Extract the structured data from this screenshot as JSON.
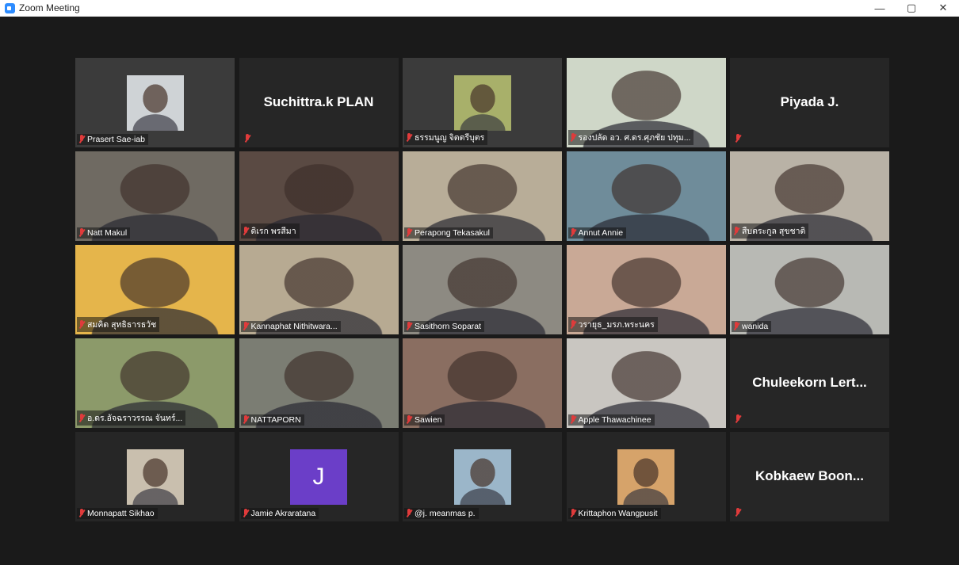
{
  "window": {
    "title": "Zoom Meeting",
    "minimize": "—",
    "maximize": "▢",
    "close": "✕"
  },
  "participants": [
    {
      "name": "Prasert Sae-iab",
      "kind": "video",
      "bg": "#3b3b3b",
      "thumb": true,
      "thumbColor": "#cfd3d6"
    },
    {
      "name": "Suchittra.k PLAN",
      "kind": "name"
    },
    {
      "name": "ธรรมนูญ จิตตรีบุตร",
      "kind": "video",
      "bg": "#3b3b3b",
      "thumb": true,
      "thumbColor": "#a8b06a"
    },
    {
      "name": "รองปลัด อว. ศ.ดร.ศุภชัย ปทุม...",
      "kind": "video",
      "bg": "#cfd7c8",
      "speaking": true
    },
    {
      "name": "Piyada J.",
      "kind": "name"
    },
    {
      "name": "Natt Makul",
      "kind": "video",
      "bg": "#6f6a62"
    },
    {
      "name": "ดิเรก พรสีมา",
      "kind": "video",
      "bg": "#5a4a43"
    },
    {
      "name": "Perapong Tekasakul",
      "kind": "video",
      "bg": "#b8ad98"
    },
    {
      "name": "Annut Annie",
      "kind": "video",
      "bg": "#6f8c9a"
    },
    {
      "name": "สืบตระกูล สุขชาติ",
      "kind": "video",
      "bg": "#b9b2a6"
    },
    {
      "name": "สมคิด สุทธิธารธวัช",
      "kind": "video",
      "bg": "#e5b54b"
    },
    {
      "name": "Kannaphat Nithitwara...",
      "kind": "video",
      "bg": "#b7aa92"
    },
    {
      "name": "Sasithorn Soparat",
      "kind": "video",
      "bg": "#8d8a82"
    },
    {
      "name": "วรายุธ_มรภ.พระนคร",
      "kind": "video",
      "bg": "#c9a996"
    },
    {
      "name": "wanida",
      "kind": "video",
      "bg": "#b8b9b4"
    },
    {
      "name": "อ.ดร.อัจฉราวรรณ จันทร์...",
      "kind": "video",
      "bg": "#8c9a6a"
    },
    {
      "name": "NATTAPORN",
      "kind": "video",
      "bg": "#7b7d73"
    },
    {
      "name": "Sawien",
      "kind": "video",
      "bg": "#8a6e61"
    },
    {
      "name": "Apple Thawachinee",
      "kind": "video",
      "bg": "#c9c6c1"
    },
    {
      "name": "Chuleekorn Lert...",
      "kind": "name"
    },
    {
      "name": "Monnapatt Sikhao",
      "kind": "video",
      "bg": "#262626",
      "thumb": true,
      "thumbColor": "#c9bfae"
    },
    {
      "name": "Jamie Akraratana",
      "kind": "avatar",
      "initial": "J"
    },
    {
      "name": "@j. meanmas p.",
      "kind": "video",
      "bg": "#262626",
      "thumb": true,
      "thumbColor": "#9bb6c9"
    },
    {
      "name": "Krittaphon Wangpusit",
      "kind": "video",
      "bg": "#262626",
      "thumb": true,
      "thumbColor": "#d6a36a"
    },
    {
      "name": "Kobkaew Boon...",
      "kind": "name"
    }
  ]
}
